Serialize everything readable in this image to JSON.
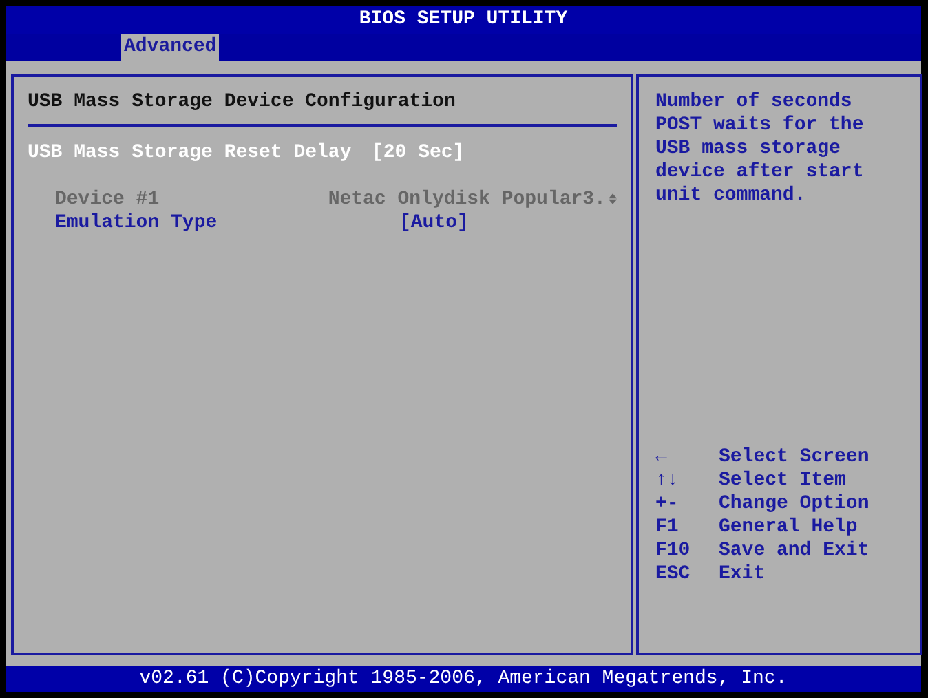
{
  "window": {
    "title": "BIOS SETUP UTILITY"
  },
  "tabs": [
    {
      "label": "Advanced",
      "selected": true
    }
  ],
  "section_title": "USB Mass Storage Device Configuration",
  "settings": [
    {
      "kind": "option",
      "label": "USB Mass Storage Reset Delay",
      "value": "[20 Sec]",
      "selected": true
    },
    {
      "kind": "info",
      "label": "Device #1",
      "value": "Netac Onlydisk Popular3.",
      "disabled": true,
      "truncated": true
    },
    {
      "kind": "option",
      "label": "Emulation Type",
      "value": "[Auto]",
      "selected": false
    }
  ],
  "help_text": "Number of seconds POST waits for the USB mass storage device after start unit command.",
  "key_help": [
    {
      "key": "←",
      "action": "Select Screen"
    },
    {
      "key": "↑↓",
      "action": "Select Item"
    },
    {
      "key": "+-",
      "action": "Change Option"
    },
    {
      "key": "F1",
      "action": "General Help"
    },
    {
      "key": "F10",
      "action": "Save and Exit"
    },
    {
      "key": "ESC",
      "action": "Exit"
    }
  ],
  "status_bar": "v02.61 (C)Copyright 1985-2006, American Megatrends, Inc."
}
